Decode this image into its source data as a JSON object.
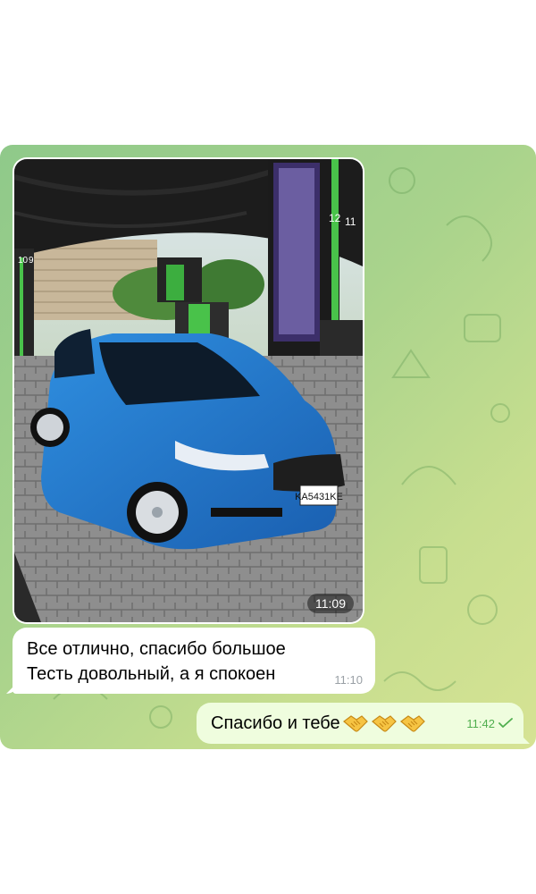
{
  "chat": {
    "photo_message": {
      "time": "11:09"
    },
    "incoming_message": {
      "lines": [
        "Все отлично, спасибо большое",
        "Тесть довольный, а я спокоен"
      ],
      "time": "11:10"
    },
    "outgoing_message": {
      "text": "Спасибо и тебе",
      "emoji": [
        "handshake-icon",
        "handshake-icon",
        "handshake-icon"
      ],
      "time": "11:42",
      "status_icon": "check-icon"
    },
    "photo_overlay": {
      "license_plate": "KA5431KE",
      "pump_numbers": [
        "12",
        "11",
        "10",
        "9"
      ]
    }
  },
  "colors": {
    "incoming_bubble": "#ffffff",
    "outgoing_bubble": "#effdde",
    "outgoing_time": "#4fae4e",
    "background_start": "#8fc98a",
    "background_end": "#d6e394"
  }
}
